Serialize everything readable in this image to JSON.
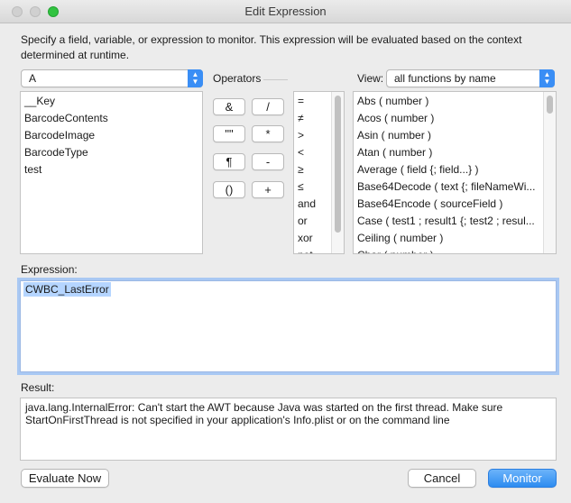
{
  "window": {
    "title": "Edit Expression"
  },
  "intro": "Specify a field, variable, or expression to monitor. This expression will be evaluated based on the context determined at runtime.",
  "table_selector": {
    "value": "A"
  },
  "fields": [
    "__Key",
    "BarcodeContents",
    "BarcodeImage",
    "BarcodeType",
    "test"
  ],
  "operators": {
    "label": "Operators",
    "buttons": [
      "&",
      "/",
      "\"\"",
      "*",
      "¶",
      "-",
      "()",
      "+"
    ],
    "comparison": [
      "=",
      "≠",
      ">",
      "<",
      "≥",
      "≤",
      "and",
      "or",
      "xor",
      "not"
    ]
  },
  "view": {
    "label": "View:",
    "value": "all functions by name"
  },
  "functions": [
    "Abs ( number )",
    "Acos ( number )",
    "Asin ( number )",
    "Atan ( number )",
    "Average ( field {; field...} )",
    "Base64Decode ( text {; fileNameWi...",
    "Base64Encode ( sourceField )",
    "Case ( test1 ; result1 {; test2 ; resul...",
    "Ceiling ( number )",
    "Char ( number )"
  ],
  "expression": {
    "label": "Expression:",
    "value": "CWBC_LastError"
  },
  "result": {
    "label": "Result:",
    "value": "java.lang.InternalError: Can't start the AWT because Java was started on the first thread.  Make sure StartOnFirstThread is not specified in your application's Info.plist or on the command line"
  },
  "buttons": {
    "evaluate": "Evaluate Now",
    "cancel": "Cancel",
    "monitor": "Monitor"
  }
}
